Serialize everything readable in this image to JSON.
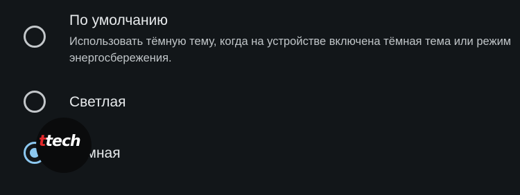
{
  "theme_options": [
    {
      "label": "По умолчанию",
      "description": "Использовать тёмную тему, когда на устройстве включена тёмная тема или режим энергосбережения.",
      "selected": false
    },
    {
      "label": "Светлая",
      "selected": false
    },
    {
      "label": "Тёмная",
      "selected": true
    }
  ],
  "watermark": {
    "accent": "t",
    "text": "tech"
  },
  "colors": {
    "background": "#121619",
    "accent": "#8cc8f0",
    "radio_border": "#c3c7ca",
    "title_text": "#e6e9eb",
    "desc_text": "#c0c5c8",
    "watermark_red": "#e3282b"
  }
}
